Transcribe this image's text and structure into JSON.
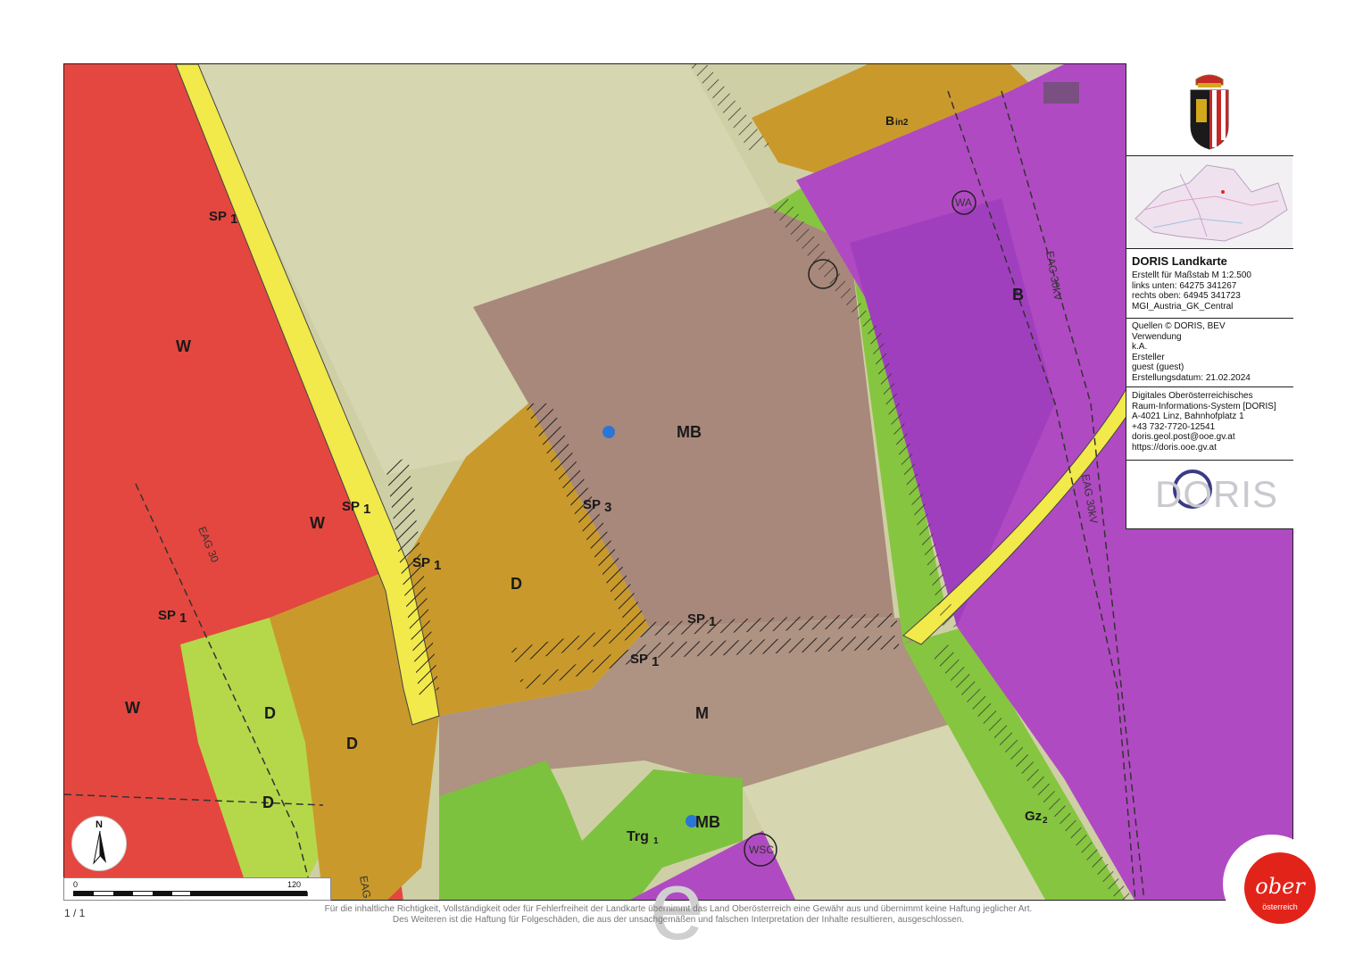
{
  "panel": {
    "title": "DORIS Landkarte",
    "scale_line": "Erstellt für Maßstab M 1:2.500",
    "coord_ll": "links unten: 64275 341267",
    "coord_ur": "rechts oben: 64945 341723",
    "crs": "MGI_Austria_GK_Central",
    "sources": "Quellen © DORIS, BEV",
    "usage_label": "Verwendung",
    "usage_value": "k.A.",
    "author_label": "Ersteller",
    "author_value": "guest (guest)",
    "created": "Erstellungsdatum: 21.02.2024",
    "org1": "Digitales Oberösterreichisches",
    "org2": "Raum-Informations-System [DORIS]",
    "address": "A-4021 Linz, Bahnhofplatz 1",
    "phone": "+43 732-7720-12541",
    "email": "doris.geol.post@ooe.gv.at",
    "web": "https://doris.ooe.gv.at",
    "logo_text": "DORIS"
  },
  "map": {
    "zones": {
      "W1": "W",
      "W2": "W",
      "W3": "W",
      "MB1": "MB",
      "MB2": "MB",
      "D1": "D",
      "D2": "D",
      "D3": "D",
      "D4": "D",
      "M": "M",
      "B": "B",
      "Bin2": "B",
      "Bin2sub": "in2",
      "Trg1": "Trg",
      "Trg1sub": "1",
      "Gz2": "Gz",
      "Gz2sub": "2"
    },
    "sp": {
      "sp1a": "SP",
      "sp1a_sub": "1",
      "sp1b": "SP",
      "sp1b_sub": "1",
      "sp1c": "SP",
      "sp1c_sub": "1",
      "sp1d": "SP",
      "sp1d_sub": "1",
      "sp1e": "SP",
      "sp1e_sub": "1",
      "sp1f": "SP",
      "sp1f_sub": "1",
      "sp3": "SP",
      "sp3_sub": "3"
    },
    "lines": {
      "eag30_left": "EAG 30",
      "eag30_right1": "EAG 30kV",
      "eag30_right2": "EAG 30kV",
      "eag_bottom": "EAG",
      "wsc": "WSC",
      "wa": "WA"
    },
    "colors": {
      "residential": "#e4473f",
      "mixed": "#c99a2b",
      "industrial": "#a8887a",
      "business": "#b04ac2",
      "green": "#86c540",
      "agri": "#cfcfa6",
      "road": "#f2e94a"
    }
  },
  "scale": {
    "zero": "0",
    "max": "120",
    "unit": "m"
  },
  "north": {
    "label": "N"
  },
  "footer": {
    "page": "1 / 1",
    "disclaimer1": "Für die inhaltliche Richtigkeit, Vollständigkeit oder für Fehlerfreiheit der Landkarte übernimmt das Land Oberösterreich eine Gewähr aus und übernimmt keine Haftung jeglicher Art.",
    "disclaimer2": "Des Weiteren ist die Haftung für Folgeschäden, die aus der unsachgemäßen und falschen Interpretation der Inhalte resultieren, ausgeschlossen.",
    "watermark": "e"
  },
  "ooe_logo": {
    "main": "ober",
    "sub": "österreich"
  }
}
